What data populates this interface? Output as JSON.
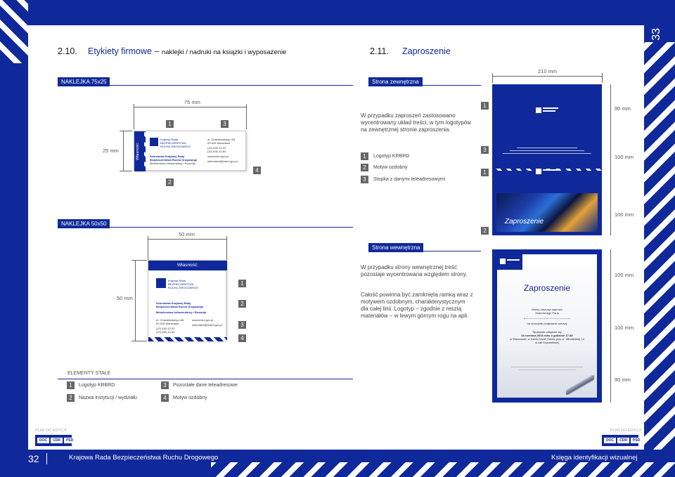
{
  "page": {
    "number_left": "32",
    "number_right": "33",
    "footer_left": "Krajowa Rada Bezpieczeństwa Ruchu Drogowego",
    "footer_right": "Księga identyfikacji wizualnej",
    "files_label": "PLIKI DO EDYCJI",
    "formats": [
      "DOC",
      "CDR",
      "PSD"
    ]
  },
  "section_left": {
    "number": "2.10.",
    "title": "Etykiety firmowe",
    "dash": "–",
    "subtitle": "naklejki / nadruki na książki i wyposażenie",
    "sticker1": {
      "bar": "NAKLEJKA 75x25",
      "width": "75 mm",
      "height": "25 mm",
      "vertical_label": "Własność:",
      "org_line1": "Krajowa Rada",
      "org_line2": "BEZPIECZEŃSTWA",
      "org_line3": "RUCHU DROGOWEGO",
      "unit1": "Sekretariat Krajowej Rady",
      "unit2": "Bezpieczeństwa Ruchu Drogowego",
      "ministry": "Ministerstwo Infrastruktury i Rozwoju",
      "addr1": "ul. Chałubińskiego 4/6",
      "addr2": "00-928 Warszawa",
      "phone": "(22) 630-12-02",
      "fax": "(22) 630-10-60",
      "www": "www.krbrd.gov.pl",
      "email": "sekretariat@krbrd.gov.pl",
      "markers": [
        "1",
        "3",
        "2",
        "4"
      ]
    },
    "sticker2": {
      "bar": "NAKLEJKA 50x50",
      "width": "50 mm",
      "height": "50 mm",
      "title": "Własność:",
      "org_line1": "Krajowa Rada",
      "org_line2": "BEZPIECZEŃSTWA",
      "org_line3": "RUCHU DROGOWEGO",
      "unit1": "Sekretariat Krajowej Rady",
      "unit2": "Bezpieczeństwa Ruchu Drogowego",
      "ministry": "Ministerstwo Infrastruktury i Rozwoju",
      "addr1": "ul. Chałubińskiego 4/6",
      "addr2": "00-928 Warszawa",
      "phone": "(22) 630-12-02",
      "fax": "(22) 630-10-60",
      "www": "www.krbrd.gov.pl",
      "email": "sekretariat@krbrd.gov.pl",
      "markers": [
        "1",
        "2",
        "3",
        "4"
      ]
    },
    "legend": {
      "title": "ELEMENTY STAŁE",
      "items": [
        {
          "num": "1",
          "label": "Logotyp KRBRD"
        },
        {
          "num": "3",
          "label": "Pozostałe dane teleadresowe"
        },
        {
          "num": "2",
          "label": "Nazwa instytucji / wydziału"
        },
        {
          "num": "4",
          "label": "Motyw ozdobny"
        }
      ]
    }
  },
  "section_right": {
    "number": "2.11.",
    "title": "Zaproszenie",
    "outer_bar": "Strona zewnętrzna",
    "inner_bar": "Strona wewnętrzna",
    "width_dim": "210 mm",
    "outer_text": "W przypadku zaproszeń zastosowano wycentrowany układ treści, w tym logotypów na zewnętrznej stronie zaproszenia.",
    "legend": [
      {
        "num": "1",
        "label": "Logotyp KRBRD"
      },
      {
        "num": "2",
        "label": "Motyw ozdobny"
      },
      {
        "num": "3",
        "label": "Stopka z danymi teleadresowymi"
      }
    ],
    "outer_dims": [
      "90 mm",
      "100 mm",
      "100 mm"
    ],
    "outer_markers": [
      "1",
      "3",
      "1",
      "2"
    ],
    "cover_title": "Zaproszenie",
    "inner_text1": "W przypadku strony wewnętrznej treść pozostaje wycentrowana względem strony.",
    "inner_text2": "Całość powinna być zamknięta ramką wraz z motywem ozdobnym, charakterystycznym dla całej linii. Logotyp – zgodnie z resztą materiałów – w lewym górnym rogu na apli.",
    "inner_dims": [
      "100 mm",
      "100 mm",
      "90 mm"
    ],
    "inner": {
      "title": "Zaproszenie",
      "line1": "Mamy zaszczyt zaprosić",
      "line2": "Szanownego Pana",
      "line3": "na uroczyste podpisanie umowy",
      "line4": "Spotkanie odbędzie się",
      "line5": "26 czerwca 2014 roku o godzinie 17:30",
      "line6": "w Warszawie, w hotelu Novel Hotels przy ul. Włodarskiej 14",
      "line7": "w sali Kryształowej"
    }
  }
}
